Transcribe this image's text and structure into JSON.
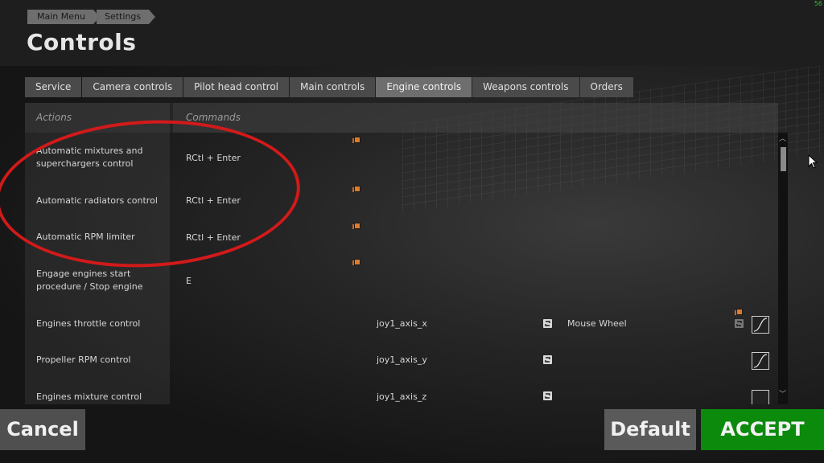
{
  "breadcrumb": {
    "item1": "Main Menu",
    "item2": "Settings"
  },
  "page_title": "Controls",
  "fps": "56",
  "tabs": [
    {
      "label": "Service"
    },
    {
      "label": "Camera controls"
    },
    {
      "label": "Pilot head control"
    },
    {
      "label": "Main controls"
    },
    {
      "label": "Engine controls",
      "active": true
    },
    {
      "label": "Weapons controls"
    },
    {
      "label": "Orders"
    }
  ],
  "table_header": {
    "actions": "Actions",
    "commands": "Commands"
  },
  "rows": [
    {
      "action": "Automatic mixtures and superchargers control",
      "command": "RCtl + Enter"
    },
    {
      "action": "Automatic radiators control",
      "command": "RCtl + Enter"
    },
    {
      "action": "Automatic RPM limiter",
      "command": "RCtl + Enter"
    },
    {
      "action": "Engage engines start procedure / Stop engine",
      "command": "E"
    },
    {
      "action": "Engines throttle control",
      "axis": "joy1_axis_x",
      "axis2": "Mouse Wheel"
    },
    {
      "action": "Propeller RPM control",
      "axis": "joy1_axis_y"
    },
    {
      "action": "Engines mixture control",
      "axis": "joy1_axis_z"
    }
  ],
  "buttons": {
    "cancel": "Cancel",
    "default": "Default",
    "accept": "ACCEPT"
  },
  "colors": {
    "accept_bg": "#0c8a0c",
    "highlight_circle": "#d21a1a",
    "icon_orange": "#e07a2a"
  },
  "icons": [
    "orange-copy-icon",
    "invert-axis-icon",
    "response-curve-icon",
    "mouse-cursor-icon"
  ]
}
